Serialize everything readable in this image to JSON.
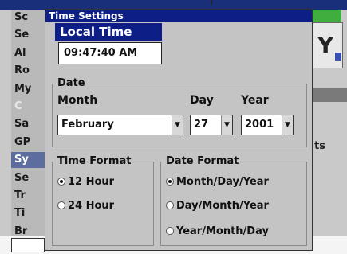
{
  "background": {
    "menu_items": [
      {
        "label": "Sc",
        "dim": false,
        "selected": false
      },
      {
        "label": "Se",
        "dim": false,
        "selected": false
      },
      {
        "label": "Al",
        "dim": false,
        "selected": false
      },
      {
        "label": "Ro",
        "dim": false,
        "selected": false
      },
      {
        "label": "My",
        "dim": false,
        "selected": false
      },
      {
        "label": "C",
        "dim": true,
        "selected": false
      },
      {
        "label": "Sa",
        "dim": false,
        "selected": false
      },
      {
        "label": "GP",
        "dim": false,
        "selected": false
      },
      {
        "label": "Sy",
        "dim": false,
        "selected": true
      },
      {
        "label": "Se",
        "dim": false,
        "selected": false
      },
      {
        "label": "Tr",
        "dim": false,
        "selected": false
      },
      {
        "label": "Ti",
        "dim": false,
        "selected": false
      },
      {
        "label": "Br",
        "dim": false,
        "selected": false
      }
    ],
    "right_text": "ts",
    "right_icon": "Y"
  },
  "dialog": {
    "title": "Time Settings",
    "local_time_label": "Local Time",
    "local_time_value": "09:47:40 AM",
    "date": {
      "group_label": "Date",
      "month_label": "Month",
      "day_label": "Day",
      "year_label": "Year",
      "month_value": "February",
      "day_value": "27",
      "year_value": "2001"
    },
    "time_format": {
      "group_label": "Time Format",
      "options": [
        "12 Hour",
        "24 Hour"
      ],
      "selected": 0
    },
    "date_format": {
      "group_label": "Date Format",
      "options": [
        "Month/Day/Year",
        "Day/Month/Year",
        "Year/Month/Day"
      ],
      "selected": 0
    }
  },
  "colors": {
    "titlebar": "#0d1f86",
    "dialog_bg": "#c4c4c4",
    "selected_menu": "#5d6e9e"
  }
}
